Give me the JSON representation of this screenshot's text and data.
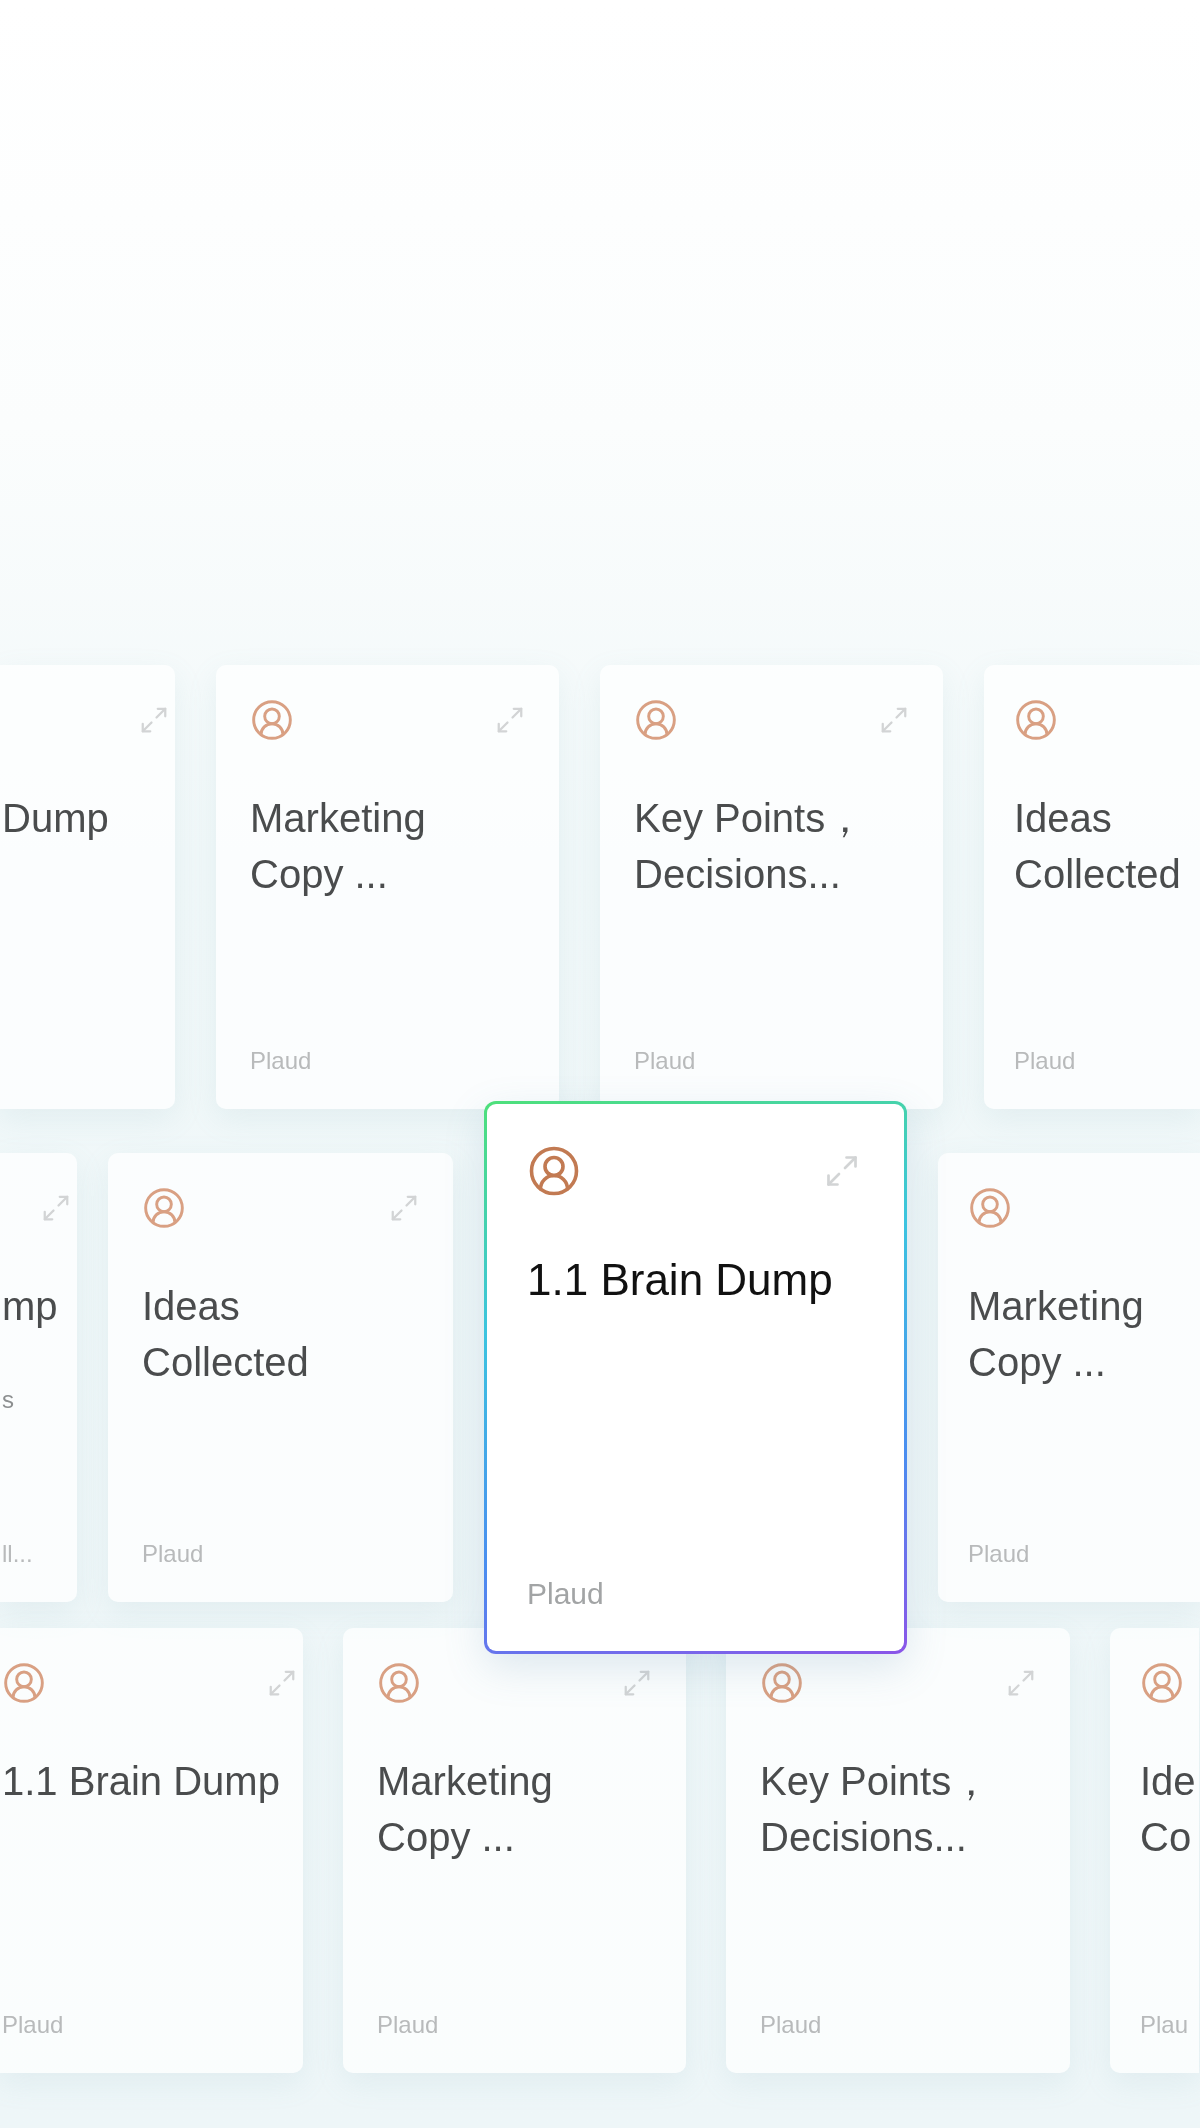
{
  "rows": [
    {
      "cards": [
        {
          "kind": "clipped_left",
          "selected": false,
          "avatar": false,
          "expand": true,
          "title_lines": [
            "Dump"
          ]
        },
        {
          "kind": "full",
          "selected": false,
          "avatar": true,
          "expand": true,
          "title_lines": [
            "Marketing",
            "Copy ..."
          ],
          "footer": "Plaud"
        },
        {
          "kind": "full",
          "selected": false,
          "avatar": true,
          "expand": true,
          "title_lines": [
            "Key Points，",
            "Decisions..."
          ],
          "footer": "Plaud"
        },
        {
          "kind": "clipped_right",
          "selected": false,
          "avatar": true,
          "expand": false,
          "title_lines": [
            "Ideas",
            "Collected"
          ],
          "footer": "Plaud"
        }
      ]
    },
    {
      "cards": [
        {
          "kind": "clipped_left",
          "selected": false,
          "avatar": false,
          "expand": true,
          "title_lines": [
            "mp"
          ],
          "subtitle": "s",
          "footer": "ll..."
        },
        {
          "kind": "full",
          "selected": false,
          "avatar": true,
          "expand": true,
          "title_lines": [
            "Ideas",
            "Collected"
          ],
          "footer": "Plaud"
        },
        {
          "kind": "full",
          "selected": true,
          "avatar": true,
          "expand": true,
          "title_lines": [
            "1.1 Brain Dump"
          ],
          "footer": "Plaud"
        },
        {
          "kind": "clipped_right",
          "selected": false,
          "avatar": true,
          "expand": false,
          "title_lines": [
            "Marketing",
            "Copy ..."
          ],
          "footer": "Plaud"
        }
      ]
    },
    {
      "cards": [
        {
          "kind": "clipped_left",
          "selected": false,
          "avatar": true,
          "expand": true,
          "title_lines": [
            "1.1 Brain Dump"
          ],
          "footer": "Plaud"
        },
        {
          "kind": "full",
          "selected": false,
          "avatar": true,
          "expand": true,
          "title_lines": [
            "Marketing",
            "Copy ..."
          ],
          "footer": "Plaud"
        },
        {
          "kind": "full",
          "selected": false,
          "avatar": true,
          "expand": true,
          "title_lines": [
            "Key Points，",
            "Decisions..."
          ],
          "footer": "Plaud"
        },
        {
          "kind": "clipped_right",
          "selected": false,
          "avatar": true,
          "expand": false,
          "title_lines": [
            "Ide",
            "Co"
          ],
          "footer": "Plau"
        }
      ]
    }
  ]
}
